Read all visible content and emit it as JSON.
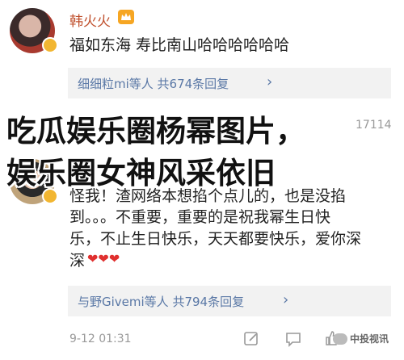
{
  "post1": {
    "author": "韩火火",
    "badge": "crown",
    "text": "福如东海 寿比南山哈哈哈哈哈哈",
    "reply_summary": "细细粒mi等人 共674条回复",
    "chevron": "›"
  },
  "overlay": {
    "line1": "吃瓜娱乐圈杨幂图片，",
    "line2": "娱乐圈女神风采依旧"
  },
  "partial_count": "17114",
  "post2": {
    "text_line1": "怪我！渣网络本想掐个点儿的，也是没掐",
    "text_line2": "到。。。不重要，重要的是祝我幂生日快",
    "text_line3": "乐，不止生日快乐，天天都要快乐，爱你深",
    "text_line4": "深",
    "hearts": "❤❤❤",
    "reply_summary": "与野Givemi等人 共794条回复",
    "chevron": "›",
    "time": "9-12 01:31"
  },
  "watermark": "中投视讯",
  "colors": {
    "name": "#c0502d",
    "link": "#5a78a6",
    "heart": "#e0302f"
  }
}
